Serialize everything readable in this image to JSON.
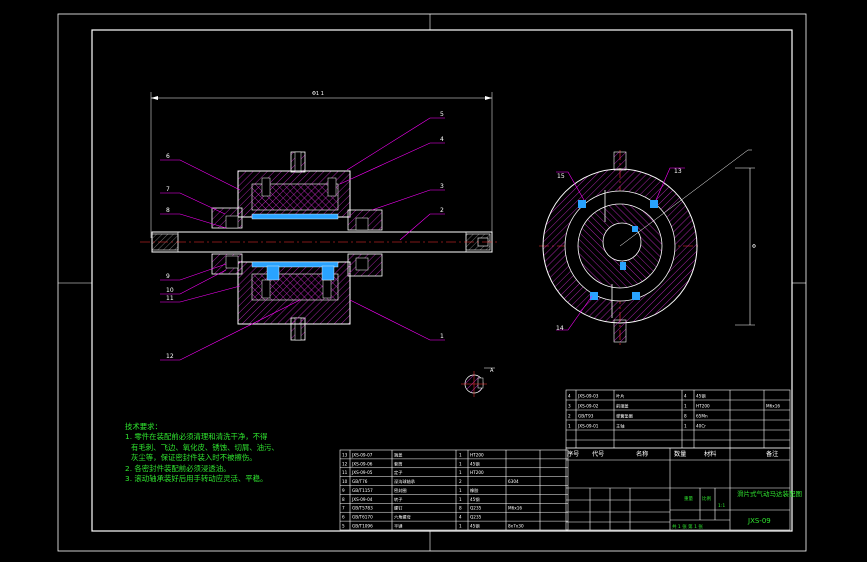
{
  "drawing": {
    "sheet_colors": {
      "background": "#000000",
      "frame": "#ffffff",
      "outline": "#ffffff",
      "dimension": "#ffffff",
      "callout": "#ff00ff",
      "centerline": "#ff3333",
      "hatch": "#ff00ff",
      "section_fill": "#29a3ff",
      "text_green": "#2fe52f",
      "titleblock_text": "#ffffff"
    },
    "technical_requirements": {
      "title": "技术要求：",
      "lines": [
        "1. 零件在装配前必须清理和清洗干净，不得",
        "有毛刺、飞边、氧化皮、锈蚀、切屑、油污、",
        "灰尘等，保证密封件装入时不被擦伤。",
        "2. 各密封件装配前必须浸透油。",
        "3. 滚动轴承装好后用手转动应灵活、平稳。"
      ]
    },
    "callouts_main": [
      "1",
      "2",
      "3",
      "4",
      "5",
      "6",
      "7",
      "8",
      "9",
      "10",
      "11",
      "12"
    ],
    "callouts_side": [
      "13",
      "14",
      "15"
    ],
    "dimension_top": "Φ1 1",
    "dimension_side": "Φ",
    "detail_label": "A",
    "parts_list_lower": [
      {
        "no": "13",
        "code": "JXS-09-07",
        "name": "端盖",
        "qty": "1",
        "material": "HT200",
        "note": ""
      },
      {
        "no": "12",
        "code": "JXS-09-06",
        "name": "套筒",
        "qty": "1",
        "material": "45钢",
        "note": ""
      },
      {
        "no": "11",
        "code": "JXS-09-05",
        "name": "定子",
        "qty": "1",
        "material": "HT200",
        "note": ""
      },
      {
        "no": "10",
        "code": "GB/T76",
        "name": "深沟球轴承",
        "qty": "2",
        "material": "",
        "note": "6304"
      },
      {
        "no": "9",
        "code": "GB/T1157",
        "name": "密封圈",
        "qty": "1",
        "material": "橡胶",
        "note": ""
      },
      {
        "no": "8",
        "code": "JXS-09-04",
        "name": "转子",
        "qty": "1",
        "material": "45钢",
        "note": ""
      },
      {
        "no": "7",
        "code": "GB/T5783",
        "name": "螺钉",
        "qty": "8",
        "material": "Q235",
        "note": "M6x16"
      },
      {
        "no": "6",
        "code": "GB/T6170",
        "name": "六角螺母",
        "qty": "4",
        "material": "Q235",
        "note": ""
      },
      {
        "no": "5",
        "code": "GB/T1096",
        "name": "平键",
        "qty": "1",
        "material": "45钢",
        "note": "8x7x30"
      }
    ],
    "parts_list_upper": [
      {
        "no": "4",
        "code": "JXS-09-03",
        "name": "叶片",
        "qty": "4",
        "material": "45钢",
        "note": ""
      },
      {
        "no": "3",
        "code": "JXS-09-02",
        "name": "前端盖",
        "qty": "1",
        "material": "HT200",
        "note": "M6x16"
      },
      {
        "no": "2",
        "code": "GB/T93",
        "name": "弹簧垫圈",
        "qty": "8",
        "material": "65Mn",
        "note": ""
      },
      {
        "no": "1",
        "code": "JXS-09-01",
        "name": "主轴",
        "qty": "1",
        "material": "40Cr",
        "note": ""
      }
    ],
    "parts_header": {
      "no": "序号",
      "code": "代号",
      "name": "名称",
      "qty": "数量",
      "material": "材料",
      "note": "备注"
    },
    "title_block": {
      "title": "滑片式气动马达装配图",
      "drawing_no": "JXS-09",
      "scale_label": "比例",
      "scale": "1:1",
      "sheet": "共 1 张  第 1 张",
      "weight_label": "重量"
    }
  }
}
